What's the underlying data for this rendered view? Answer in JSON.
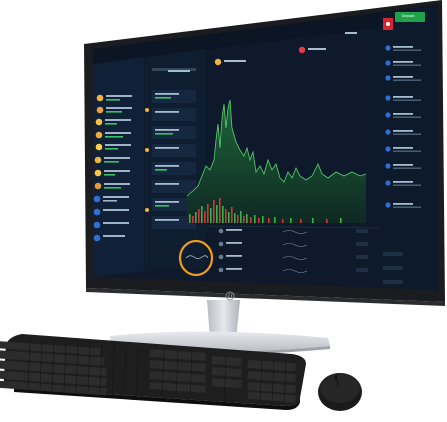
{
  "brand": {
    "logo": "hp-logo-icon"
  },
  "app": {
    "header": {
      "deposit_button": "Deposit",
      "account_badge_color": "#d8242f",
      "deposit_color": "#1fa24a"
    },
    "chart": {
      "area_color": "#1f6b3a",
      "line_color": "#57d36b",
      "volume_up_color": "#34b24b",
      "volume_down_color": "#d8323c"
    },
    "sidebar_left": {
      "items_count_visible": 9
    },
    "sidebar_right": {
      "items_count_visible": 10
    },
    "highlight": {
      "ring_color": "#f19a1b",
      "target": "mini-sparkline"
    }
  },
  "colors": {
    "screen_bg": "#0e1a2b",
    "panel_bg": "#111f33",
    "bezel": "#1a1a1a",
    "stand": "#c9ccd1",
    "keyboard": "#1e1e1e"
  }
}
